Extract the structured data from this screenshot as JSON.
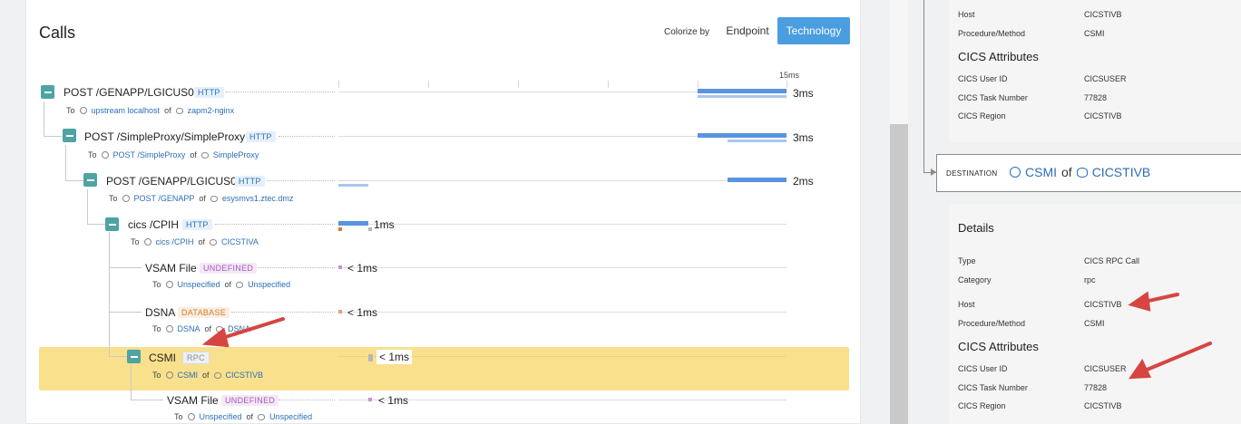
{
  "calls": {
    "title": "Calls",
    "colorize_label": "Colorize by",
    "endpoint_label": "Endpoint",
    "technology_label": "Technology",
    "scale_max": "15ms",
    "rows": [
      {
        "name": "POST /GENAPP/LGICUS01",
        "tag": "HTTP",
        "to": "To",
        "endpoint": "upstream localhost",
        "of": "of",
        "service": "zapm2-nginx",
        "duration": "3ms"
      },
      {
        "name": "POST /SimpleProxy/SimpleProxy",
        "tag": "HTTP",
        "to": "To",
        "endpoint": "POST /SimpleProxy",
        "of": "of",
        "service": "SimpleProxy",
        "duration": "3ms"
      },
      {
        "name": "POST /GENAPP/LGICUS01",
        "tag": "HTTP",
        "to": "To",
        "endpoint": "POST /GENAPP",
        "of": "of",
        "service": "esysmvs1.ztec.dmz",
        "duration": "2ms"
      },
      {
        "name": "cics /CPIH",
        "tag": "HTTP",
        "to": "To",
        "endpoint": "cics /CPIH",
        "of": "of",
        "service": "CICSTIVA",
        "duration": "1ms"
      },
      {
        "name": "VSAM File",
        "tag": "UNDEFINED",
        "to": "To",
        "endpoint": "Unspecified",
        "of": "of",
        "service": "Unspecified",
        "duration": "< 1ms"
      },
      {
        "name": "DSNA",
        "tag": "DATABASE",
        "to": "To",
        "endpoint": "DSNA",
        "of": "of",
        "service": "DSNA",
        "duration": "< 1ms"
      },
      {
        "name": "CSMI",
        "tag": "RPC",
        "to": "To",
        "endpoint": "CSMI",
        "of": "of",
        "service": "CICSTIVB",
        "duration": "< 1ms"
      },
      {
        "name": "VSAM File",
        "tag": "UNDEFINED",
        "to": "To",
        "endpoint": "Unspecified",
        "of": "of",
        "service": "Unspecified",
        "duration": "< 1ms"
      }
    ]
  },
  "details_top": {
    "host_label": "Host",
    "host": "CICSTIVB",
    "proc_label": "Procedure/Method",
    "proc": "CSMI",
    "cics_title": "CICS Attributes",
    "user_label": "CICS User ID",
    "user": "CICSUSER",
    "task_label": "CICS Task Number",
    "task": "77828",
    "region_label": "CICS Region",
    "region": "CICSTIVB"
  },
  "destination": {
    "label": "DESTINATION",
    "endpoint": "CSMI",
    "of": "of",
    "service": "CICSTIVB"
  },
  "details": {
    "title": "Details",
    "type_label": "Type",
    "type": "CICS RPC Call",
    "category_label": "Category",
    "category": "rpc",
    "host_label": "Host",
    "host": "CICSTIVB",
    "proc_label": "Procedure/Method",
    "proc": "CSMI",
    "cics_title": "CICS Attributes",
    "user_label": "CICS User ID",
    "user": "CICSUSER",
    "task_label": "CICS Task Number",
    "task": "77828",
    "region_label": "CICS Region",
    "region": "CICSTIVB"
  },
  "colors": {
    "accent": "#4a9ee0",
    "highlight": "#f9e08c",
    "toggle": "#4fa3a3",
    "bar": "#5a93e0",
    "annotation_arrow": "#d64541"
  }
}
